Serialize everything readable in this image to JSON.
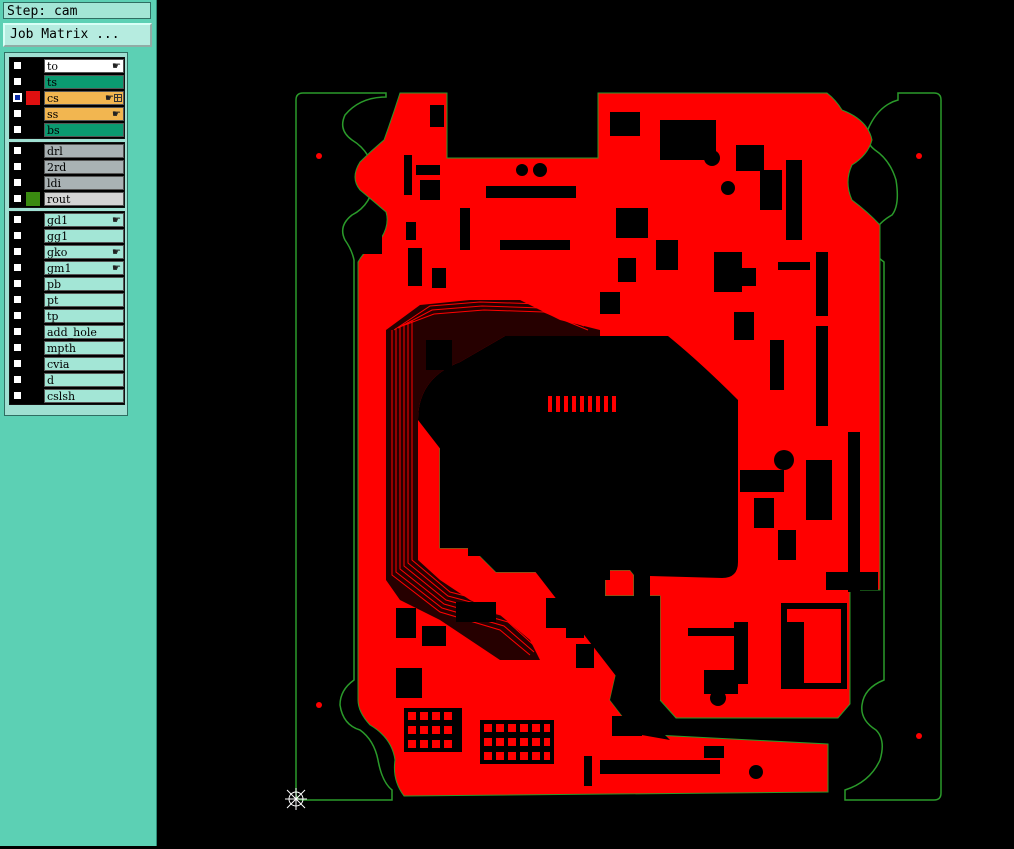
{
  "step_label": "Step: cam",
  "job_matrix_button": "Job Matrix ...",
  "layer_groups": [
    {
      "layers": [
        {
          "name": "to",
          "color": "#ffffff",
          "swatch": "#000000",
          "hand": true
        },
        {
          "name": "ts",
          "color": "#0b9a70",
          "swatch": "#000000",
          "hand": false
        },
        {
          "name": "cs",
          "color": "#f2b650",
          "swatch": "#e01010",
          "hand": true,
          "grid": true,
          "active": true
        },
        {
          "name": "ss",
          "color": "#f2b650",
          "swatch": "#000000",
          "hand": true
        },
        {
          "name": "bs",
          "color": "#0b9a70",
          "swatch": "#000000",
          "hand": false
        }
      ]
    },
    {
      "layers": [
        {
          "name": "drl",
          "color": "#a9b2b4",
          "swatch": "#000000"
        },
        {
          "name": "2rd",
          "color": "#a9b2b4",
          "swatch": "#000000"
        },
        {
          "name": "ldi",
          "color": "#a9b2b4",
          "swatch": "#000000"
        },
        {
          "name": "rout",
          "color": "#d4d4d4",
          "swatch": "#3a8a10"
        }
      ]
    },
    {
      "layers": [
        {
          "name": "gd1",
          "color": "#a3e6d6",
          "swatch": "#000000",
          "hand": true
        },
        {
          "name": "gg1",
          "color": "#a3e6d6",
          "swatch": "#000000"
        },
        {
          "name": "gko",
          "color": "#a3e6d6",
          "swatch": "#000000",
          "hand": true
        },
        {
          "name": "gm1",
          "color": "#a3e6d6",
          "swatch": "#000000",
          "hand": true
        },
        {
          "name": "pb",
          "color": "#a3e6d6",
          "swatch": "#000000"
        },
        {
          "name": "pt",
          "color": "#a3e6d6",
          "swatch": "#000000"
        },
        {
          "name": "tp",
          "color": "#a3e6d6",
          "swatch": "#000000"
        },
        {
          "name": "add_hole",
          "color": "#a3e6d6",
          "swatch": "#000000"
        },
        {
          "name": "mpth",
          "color": "#a3e6d6",
          "swatch": "#000000"
        },
        {
          "name": "cvia",
          "color": "#a3e6d6",
          "swatch": "#000000"
        },
        {
          "name": "d",
          "color": "#a3e6d6",
          "swatch": "#000000"
        },
        {
          "name": "cslsh",
          "color": "#a3e6d6",
          "swatch": "#000000"
        }
      ]
    }
  ],
  "colors": {
    "copper": "#ff0000",
    "outline": "#2a9a2a",
    "background": "#000000"
  }
}
